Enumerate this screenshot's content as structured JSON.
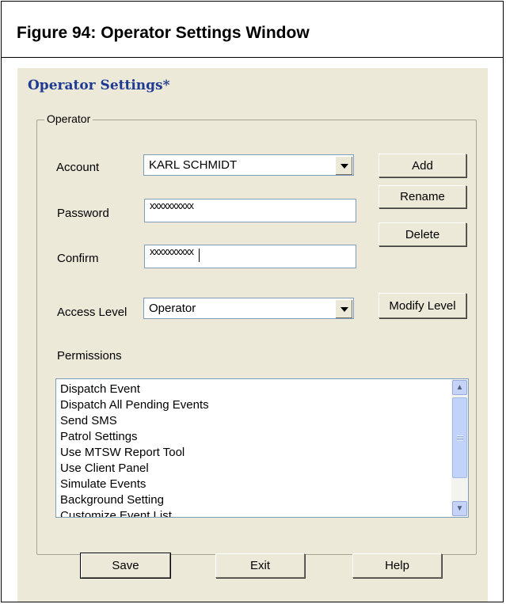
{
  "figure": {
    "caption": "Figure 94:  Operator Settings Window"
  },
  "window": {
    "title": "Operator Settings*"
  },
  "group": {
    "label": "Operator"
  },
  "fields": {
    "account_label": "Account",
    "account_value": "KARL SCHMIDT",
    "password_label": "Password",
    "password_value": "xxxxxxxxxx",
    "confirm_label": "Confirm",
    "confirm_value": "xxxxxxxxxx",
    "access_level_label": "Access Level",
    "access_level_value": "Operator",
    "permissions_label": "Permissions"
  },
  "buttons": {
    "add": "Add",
    "rename": "Rename",
    "delete": "Delete",
    "modify_level": "Modify Level",
    "save": "Save",
    "exit": "Exit",
    "help": "Help"
  },
  "permissions": [
    "Dispatch Event",
    "Dispatch All Pending Events",
    "Send SMS",
    "Patrol Settings",
    "Use MTSW Report Tool",
    "Use Client Panel",
    "Simulate Events",
    "Background Setting",
    "Customize Event List"
  ],
  "icons": {
    "dropdown": "chevron-down-icon",
    "scroll_up": "scroll-up-icon",
    "scroll_down": "scroll-down-icon"
  }
}
